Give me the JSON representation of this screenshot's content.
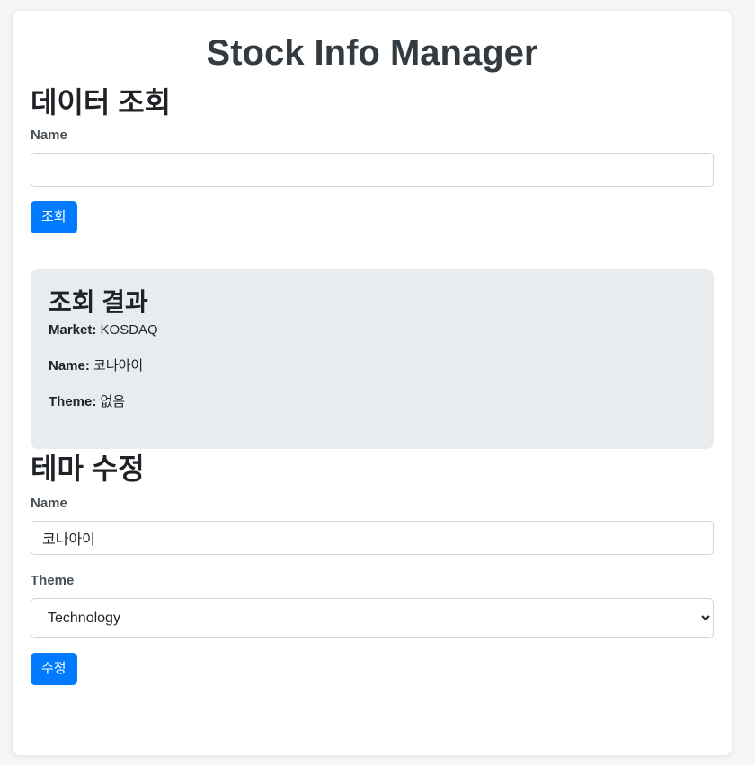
{
  "app": {
    "title": "Stock Info Manager"
  },
  "lookup": {
    "title": "데이터 조회",
    "name_label": "Name",
    "name_value": "",
    "button_label": "조회"
  },
  "result": {
    "title": "조회 결과",
    "market_label": "Market:",
    "market_value": "KOSDAQ",
    "name_label": "Name:",
    "name_value": "코나아이",
    "theme_label": "Theme:",
    "theme_value": "없음"
  },
  "edit": {
    "title": "테마 수정",
    "name_label": "Name",
    "name_value": "코나아이",
    "theme_label": "Theme",
    "theme_selected": "Technology",
    "button_label": "수정"
  },
  "colors": {
    "primary": "#007bff",
    "result_bg": "#e9ecef",
    "page_bg": "#f5f6f8"
  }
}
